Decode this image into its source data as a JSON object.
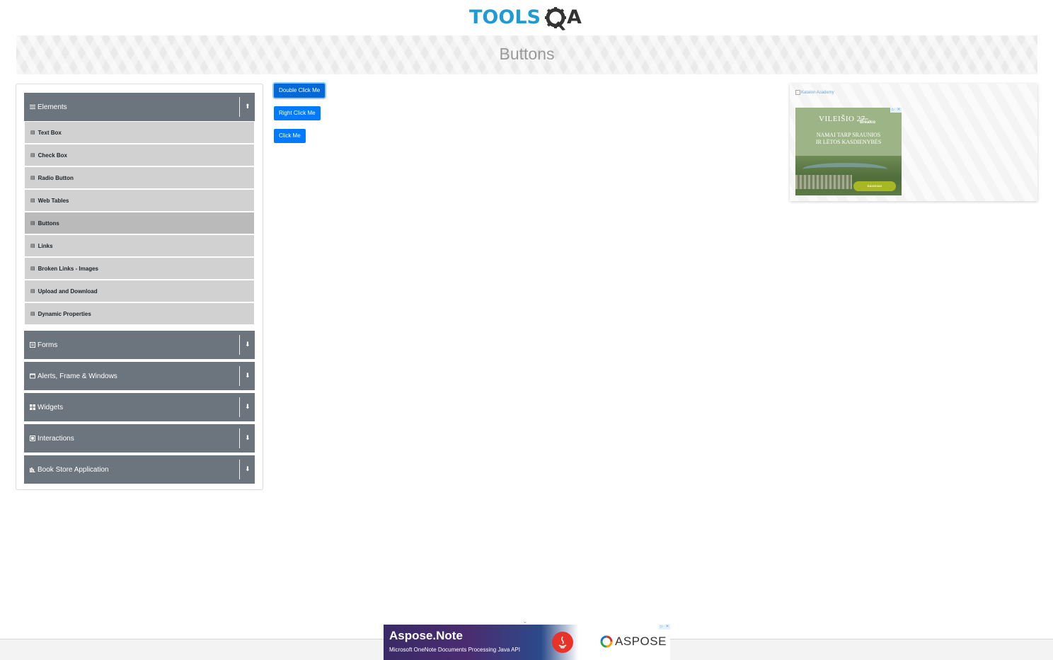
{
  "header": {
    "logo_text": "TOOLS",
    "logo_suffix": "A"
  },
  "banner": {
    "title": "Buttons"
  },
  "sidebar": {
    "groups": [
      {
        "label": "Elements",
        "icon": "hamburger-icon",
        "expanded": true,
        "arrow": "⬆",
        "items": [
          {
            "label": "Text Box"
          },
          {
            "label": "Check Box"
          },
          {
            "label": "Radio Button"
          },
          {
            "label": "Web Tables"
          },
          {
            "label": "Buttons",
            "active": true
          },
          {
            "label": "Links"
          },
          {
            "label": "Broken Links - Images"
          },
          {
            "label": "Upload and Download"
          },
          {
            "label": "Dynamic Properties"
          }
        ]
      },
      {
        "label": "Forms",
        "icon": "form-icon",
        "arrow": "⬇"
      },
      {
        "label": "Alerts, Frame & Windows",
        "icon": "window-icon",
        "arrow": "⬇"
      },
      {
        "label": "Widgets",
        "icon": "grid-icon",
        "arrow": "⬇"
      },
      {
        "label": "Interactions",
        "icon": "interaction-icon",
        "arrow": "⬇"
      },
      {
        "label": "Book Store Application",
        "icon": "book-icon",
        "arrow": "⬇"
      }
    ]
  },
  "buttons": {
    "double_click": "Double Click Me",
    "right_click": "Right Click Me",
    "click": "Click Me"
  },
  "right_ad": {
    "broken_image_alt": "Katalon Academy",
    "title": "VILEIŠIO 27",
    "sub": "Vystys",
    "brand": "Brealco",
    "line1": "NAMAI TARP SRAUNIOS",
    "line2": "IR LĖTOS KASDIENYBĖS",
    "cta": "DAUGIAU"
  },
  "bottom_ad": {
    "title": "Aspose.Note",
    "subtitle": "Microsoft OneNote Documents Processing  Java API",
    "brand": "ASPOSE"
  },
  "colors": {
    "primary": "#007bff",
    "sidebar_header": "#6c757d",
    "menu_item": "#d1d1d1",
    "menu_item_active": "#bababa",
    "logo_blue": "#1e9bd7"
  }
}
